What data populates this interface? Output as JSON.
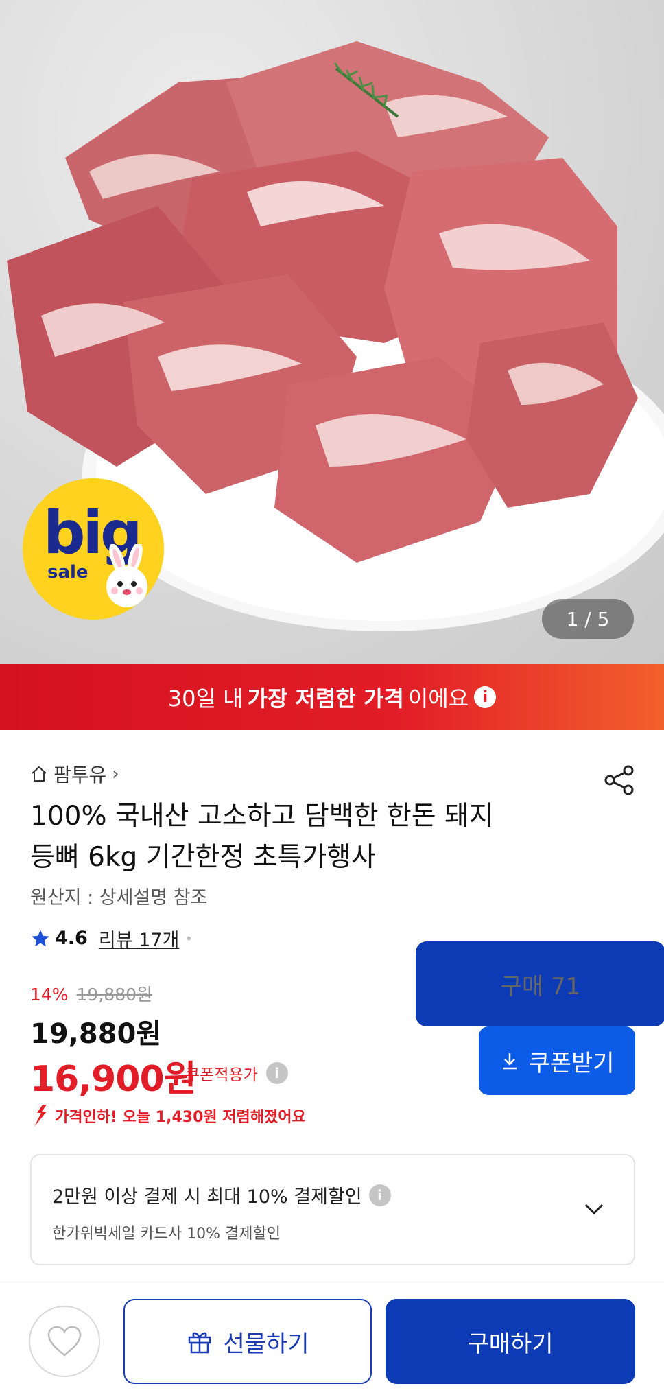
{
  "hero": {
    "badge_big": "big",
    "badge_sale": "sale",
    "image_counter": "1 / 5"
  },
  "banner": {
    "pre": "30일 내",
    "bold": "가장 저렴한 가격",
    "post": "이에요",
    "info_icon": "i"
  },
  "product": {
    "store": "팜투유",
    "title_line1": "100% 국내산 고소하고 담백한 한돈 돼지",
    "title_line2": "등뼈 6kg 기간한정 초특가행사",
    "origin": "원산지 : 상세설명 참조",
    "rating": "4.6",
    "review_count": "리뷰 17개",
    "purchase_count": "구매 71"
  },
  "pricing": {
    "discount_pct": "14%",
    "original_price": "19,880원",
    "price": "19,880원",
    "coupon_price": "16,900원",
    "coupon_label": "쿠폰적용가",
    "coupon_button": "쿠폰받기",
    "price_drop": "가격인하! 오늘 1,430원 저렴해졌어요"
  },
  "payment": {
    "line1": "2만원 이상 결제 시 최대  10% 결제할인",
    "line2": "한가위빅세일  카드사 10% 결제할인"
  },
  "bottom": {
    "gift_label": "선물하기",
    "buy_label": "구매하기"
  },
  "colors": {
    "accent_red": "#e21d27",
    "primary_blue": "#0d5ce8",
    "buy_blue": "#0c3bb5"
  }
}
